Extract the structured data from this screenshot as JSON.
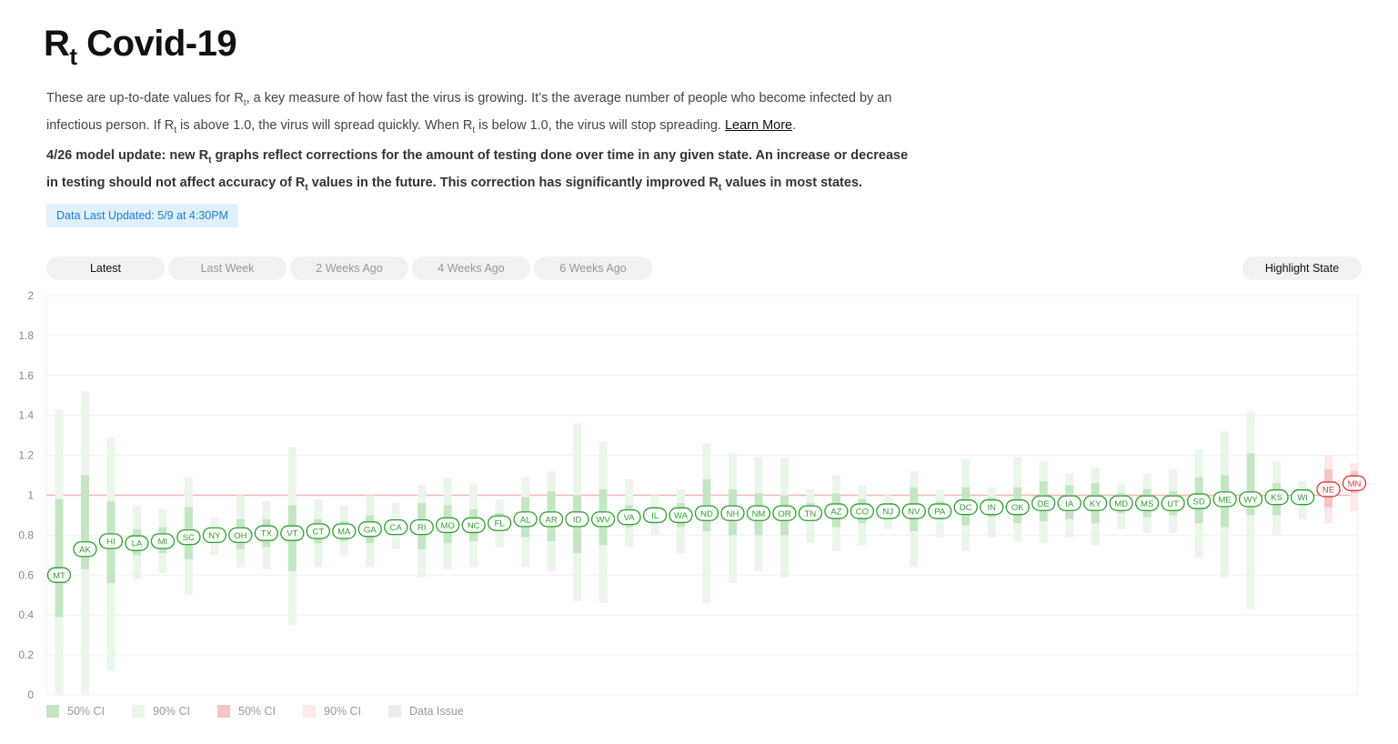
{
  "header": {
    "title_main": "R",
    "title_sub": "t",
    "title_rest": " Covid-19"
  },
  "intro": {
    "s1": "These are up-to-date values for R",
    "sub": "t",
    "s2": ", a key measure of how fast the virus is growing. It’s the average number of people who become infected by an infectious person. If R",
    "s3": " is above 1.0, the virus will spread quickly. When R",
    "s4": " is below 1.0, the virus will stop spreading. ",
    "link": "Learn More",
    "end": "."
  },
  "update": {
    "s1": "4/26 model update: new R",
    "sub": "t",
    "s2": " graphs reflect corrections for the amount of testing done over time in any given state. An increase or decrease in testing should not affect accuracy of R",
    "s3": " values in the future. This correction has significantly improved R",
    "s4": " values in most states."
  },
  "data_updated": "Data Last Updated: 5/9 at 4:30PM",
  "tabs": [
    "Latest",
    "Last Week",
    "2 Weeks Ago",
    "4 Weeks Ago",
    "6 Weeks Ago"
  ],
  "highlight_button": "Highlight State",
  "legend": [
    {
      "label": "50% CI",
      "color": "#c4e6c4"
    },
    {
      "label": "90% CI",
      "color": "#eaf6ea"
    },
    {
      "label": "50% CI",
      "color": "#f5c4c4"
    },
    {
      "label": "90% CI",
      "color": "#fde8ea"
    },
    {
      "label": "Data Issue",
      "color": "#ececec"
    }
  ],
  "colors": {
    "below_one": "#2e9e2e",
    "above_one": "#d83a3a",
    "ci50_below": "#c4e6c4",
    "ci90_below": "#eaf6ea",
    "ci50_above": "#f5c4c4",
    "ci90_above": "#fde8ea",
    "reference_line": "#f2b6b6"
  },
  "chart_data": {
    "type": "scatter",
    "title": "",
    "xlabel": "",
    "ylabel": "",
    "ylim": [
      0,
      2
    ],
    "yticks": [
      "0",
      "0.2",
      "0.4",
      "0.6",
      "0.8",
      "1",
      "1.2",
      "1.4",
      "1.6",
      "1.8",
      "2"
    ],
    "reference_line": 1,
    "grid": true,
    "states": [
      {
        "state": "MT",
        "rt": 0.6,
        "ci50": [
          0.39,
          0.98
        ],
        "ci90": [
          0.0,
          1.43
        ]
      },
      {
        "state": "AK",
        "rt": 0.73,
        "ci50": [
          0.63,
          1.1
        ],
        "ci90": [
          0.0,
          1.52
        ]
      },
      {
        "state": "HI",
        "rt": 0.77,
        "ci50": [
          0.56,
          0.97
        ],
        "ci90": [
          0.12,
          1.29
        ]
      },
      {
        "state": "LA",
        "rt": 0.76,
        "ci50": [
          0.7,
          0.83
        ],
        "ci90": [
          0.58,
          0.95
        ]
      },
      {
        "state": "MI",
        "rt": 0.77,
        "ci50": [
          0.71,
          0.84
        ],
        "ci90": [
          0.61,
          0.93
        ]
      },
      {
        "state": "SC",
        "rt": 0.79,
        "ci50": [
          0.68,
          0.94
        ],
        "ci90": [
          0.5,
          1.09
        ]
      },
      {
        "state": "NY",
        "rt": 0.8,
        "ci50": [
          0.77,
          0.83
        ],
        "ci90": [
          0.7,
          0.89
        ]
      },
      {
        "state": "OH",
        "rt": 0.8,
        "ci50": [
          0.73,
          0.88
        ],
        "ci90": [
          0.64,
          1.0
        ]
      },
      {
        "state": "TX",
        "rt": 0.81,
        "ci50": [
          0.74,
          0.88
        ],
        "ci90": [
          0.63,
          0.97
        ]
      },
      {
        "state": "VT",
        "rt": 0.81,
        "ci50": [
          0.62,
          0.95
        ],
        "ci90": [
          0.35,
          1.24
        ]
      },
      {
        "state": "CT",
        "rt": 0.82,
        "ci50": [
          0.76,
          0.88
        ],
        "ci90": [
          0.64,
          0.98
        ]
      },
      {
        "state": "MA",
        "rt": 0.82,
        "ci50": [
          0.77,
          0.87
        ],
        "ci90": [
          0.7,
          0.95
        ]
      },
      {
        "state": "GA",
        "rt": 0.83,
        "ci50": [
          0.76,
          0.9
        ],
        "ci90": [
          0.64,
          1.0
        ]
      },
      {
        "state": "CA",
        "rt": 0.84,
        "ci50": [
          0.8,
          0.88
        ],
        "ci90": [
          0.73,
          0.96
        ]
      },
      {
        "state": "RI",
        "rt": 0.84,
        "ci50": [
          0.73,
          0.96
        ],
        "ci90": [
          0.59,
          1.05
        ]
      },
      {
        "state": "MO",
        "rt": 0.85,
        "ci50": [
          0.76,
          0.95
        ],
        "ci90": [
          0.63,
          1.09
        ]
      },
      {
        "state": "NC",
        "rt": 0.85,
        "ci50": [
          0.77,
          0.93
        ],
        "ci90": [
          0.64,
          1.06
        ]
      },
      {
        "state": "FL",
        "rt": 0.86,
        "ci50": [
          0.82,
          0.91
        ],
        "ci90": [
          0.74,
          0.98
        ]
      },
      {
        "state": "AL",
        "rt": 0.88,
        "ci50": [
          0.79,
          0.99
        ],
        "ci90": [
          0.64,
          1.09
        ]
      },
      {
        "state": "AR",
        "rt": 0.88,
        "ci50": [
          0.77,
          1.02
        ],
        "ci90": [
          0.62,
          1.12
        ]
      },
      {
        "state": "ID",
        "rt": 0.88,
        "ci50": [
          0.71,
          1.0
        ],
        "ci90": [
          0.47,
          1.36
        ]
      },
      {
        "state": "WV",
        "rt": 0.88,
        "ci50": [
          0.75,
          1.03
        ],
        "ci90": [
          0.46,
          1.27
        ]
      },
      {
        "state": "VA",
        "rt": 0.89,
        "ci50": [
          0.84,
          0.95
        ],
        "ci90": [
          0.74,
          1.08
        ]
      },
      {
        "state": "IL",
        "rt": 0.9,
        "ci50": [
          0.86,
          0.94
        ],
        "ci90": [
          0.8,
          1.0
        ]
      },
      {
        "state": "WA",
        "rt": 0.9,
        "ci50": [
          0.84,
          0.96
        ],
        "ci90": [
          0.71,
          1.03
        ]
      },
      {
        "state": "ND",
        "rt": 0.91,
        "ci50": [
          0.82,
          1.08
        ],
        "ci90": [
          0.46,
          1.26
        ]
      },
      {
        "state": "NH",
        "rt": 0.91,
        "ci50": [
          0.8,
          1.03
        ],
        "ci90": [
          0.56,
          1.21
        ]
      },
      {
        "state": "NM",
        "rt": 0.91,
        "ci50": [
          0.8,
          1.01
        ],
        "ci90": [
          0.62,
          1.19
        ]
      },
      {
        "state": "OR",
        "rt": 0.91,
        "ci50": [
          0.8,
          1.0
        ],
        "ci90": [
          0.59,
          1.19
        ]
      },
      {
        "state": "TN",
        "rt": 0.91,
        "ci50": [
          0.87,
          0.96
        ],
        "ci90": [
          0.76,
          1.03
        ]
      },
      {
        "state": "AZ",
        "rt": 0.92,
        "ci50": [
          0.84,
          1.01
        ],
        "ci90": [
          0.72,
          1.1
        ]
      },
      {
        "state": "CO",
        "rt": 0.92,
        "ci50": [
          0.86,
          0.98
        ],
        "ci90": [
          0.75,
          1.05
        ]
      },
      {
        "state": "NJ",
        "rt": 0.92,
        "ci50": [
          0.89,
          0.96
        ],
        "ci90": [
          0.83,
          1.0
        ]
      },
      {
        "state": "NV",
        "rt": 0.92,
        "ci50": [
          0.82,
          1.04
        ],
        "ci90": [
          0.64,
          1.12
        ]
      },
      {
        "state": "PA",
        "rt": 0.92,
        "ci50": [
          0.88,
          0.97
        ],
        "ci90": [
          0.79,
          1.03
        ]
      },
      {
        "state": "DC",
        "rt": 0.94,
        "ci50": [
          0.85,
          1.04
        ],
        "ci90": [
          0.72,
          1.18
        ]
      },
      {
        "state": "IN",
        "rt": 0.94,
        "ci50": [
          0.89,
          0.99
        ],
        "ci90": [
          0.79,
          1.04
        ]
      },
      {
        "state": "OK",
        "rt": 0.94,
        "ci50": [
          0.86,
          1.04
        ],
        "ci90": [
          0.77,
          1.19
        ]
      },
      {
        "state": "DE",
        "rt": 0.96,
        "ci50": [
          0.87,
          1.07
        ],
        "ci90": [
          0.76,
          1.17
        ]
      },
      {
        "state": "IA",
        "rt": 0.96,
        "ci50": [
          0.88,
          1.05
        ],
        "ci90": [
          0.79,
          1.11
        ]
      },
      {
        "state": "KY",
        "rt": 0.96,
        "ci50": [
          0.86,
          1.06
        ],
        "ci90": [
          0.75,
          1.14
        ]
      },
      {
        "state": "MD",
        "rt": 0.96,
        "ci50": [
          0.91,
          1.01
        ],
        "ci90": [
          0.83,
          1.06
        ]
      },
      {
        "state": "MS",
        "rt": 0.96,
        "ci50": [
          0.89,
          1.03
        ],
        "ci90": [
          0.81,
          1.11
        ]
      },
      {
        "state": "UT",
        "rt": 0.96,
        "ci50": [
          0.9,
          1.02
        ],
        "ci90": [
          0.81,
          1.13
        ]
      },
      {
        "state": "SD",
        "rt": 0.97,
        "ci50": [
          0.86,
          1.09
        ],
        "ci90": [
          0.69,
          1.23
        ]
      },
      {
        "state": "ME",
        "rt": 0.98,
        "ci50": [
          0.84,
          1.1
        ],
        "ci90": [
          0.59,
          1.32
        ]
      },
      {
        "state": "WY",
        "rt": 0.98,
        "ci50": [
          0.9,
          1.21
        ],
        "ci90": [
          0.43,
          1.42
        ]
      },
      {
        "state": "KS",
        "rt": 0.99,
        "ci50": [
          0.9,
          1.06
        ],
        "ci90": [
          0.8,
          1.17
        ]
      },
      {
        "state": "WI",
        "rt": 0.99,
        "ci50": [
          0.95,
          1.03
        ],
        "ci90": [
          0.88,
          1.07
        ]
      },
      {
        "state": "NE",
        "rt": 1.03,
        "ci50": [
          0.94,
          1.13
        ],
        "ci90": [
          0.86,
          1.2
        ]
      },
      {
        "state": "MN",
        "rt": 1.06,
        "ci50": [
          1.01,
          1.12
        ],
        "ci90": [
          0.92,
          1.16
        ]
      }
    ]
  }
}
